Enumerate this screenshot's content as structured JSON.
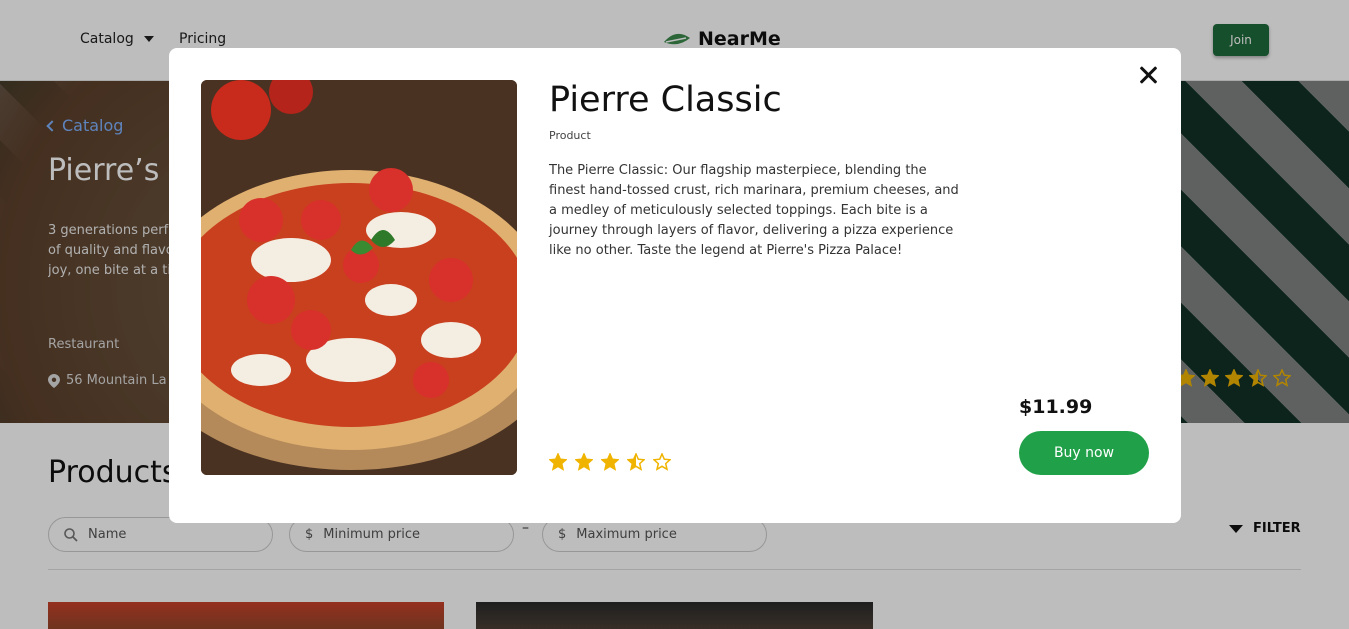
{
  "header": {
    "nav_catalog": "Catalog",
    "nav_pricing": "Pricing",
    "logo_text": "NearMe",
    "join_label": "Join"
  },
  "hero": {
    "back_label": "Catalog",
    "title": "Pierre’s P",
    "description_lines": [
      "3 generations perf",
      "of quality and flavo",
      "joy, one bite at a ti"
    ],
    "type": "Restaurant",
    "address": "56 Mountain La",
    "rating": 3.5
  },
  "products": {
    "title": "Products",
    "search_placeholder": "Name",
    "min_price_placeholder": "Minimum price",
    "max_price_placeholder": "Maximum price",
    "currency_symbol": "$",
    "range_separator": "–",
    "filter_label": "FILTER"
  },
  "modal": {
    "title": "Pierre Classic",
    "type": "Product",
    "description": "The Pierre Classic: Our flagship masterpiece, blending the finest hand-tossed crust, rich marinara, premium cheeses, and a medley of meticulously selected toppings. Each bite is a journey through layers of flavor, delivering a pizza experience like no other. Taste the legend at Pierre's Pizza Palace!",
    "rating": 3.5,
    "price": "$11.99",
    "buy_label": "Buy now"
  },
  "colors": {
    "brand_green": "#1e6b3a",
    "buy_green": "#1fa049",
    "star_gold": "#f0b400",
    "link_blue": "#7fb2ff"
  }
}
